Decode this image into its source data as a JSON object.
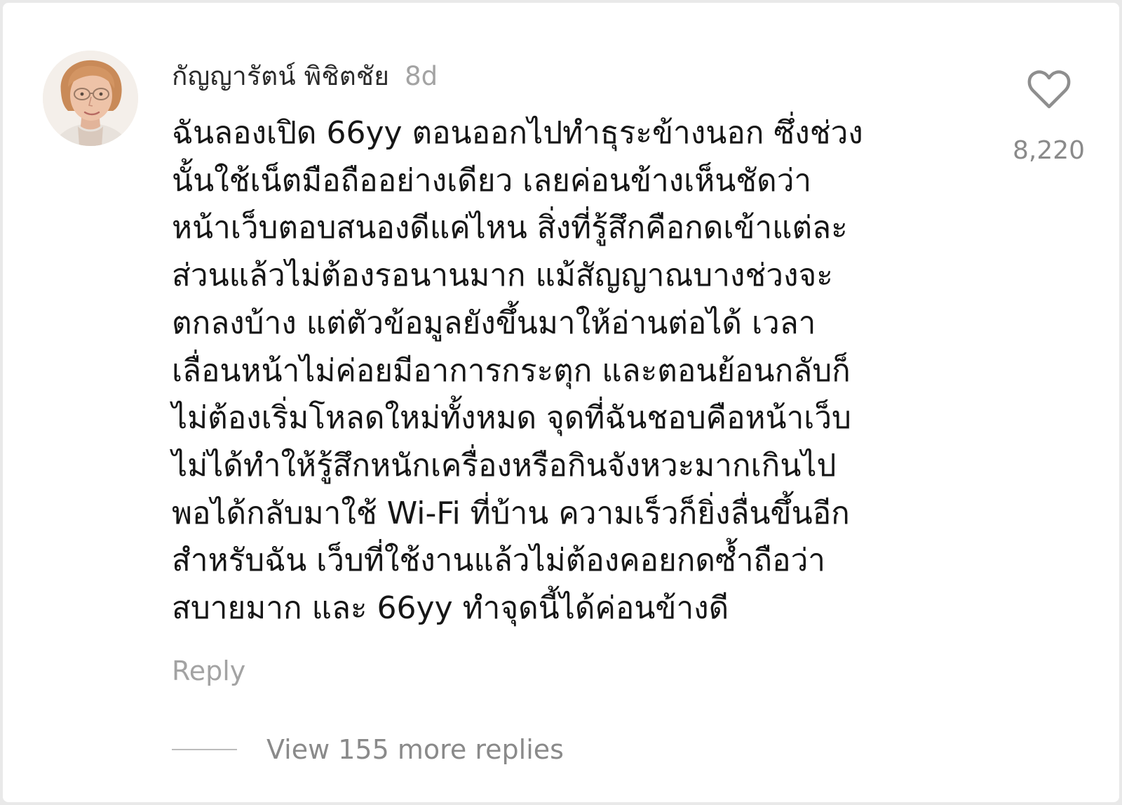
{
  "comment": {
    "username": "กัญญารัตน์ พิชิตชัย",
    "time_ago": "8d",
    "lines": [
      "ฉันลองเปิด 66yy ตอนออกไปทำธุระข้างนอก ซึ่งช่วง",
      "นั้นใช้เน็ตมือถืออย่างเดียว เลยค่อนข้างเห็นชัดว่า",
      "หน้าเว็บตอบสนองดีแค่ไหน สิ่งที่รู้สึกคือกดเข้าแต่ละ",
      "ส่วนแล้วไม่ต้องรอนานมาก แม้สัญญาณบางช่วงจะ",
      "ตกลงบ้าง แต่ตัวข้อมูลยังขึ้นมาให้อ่านต่อได้ เวลา",
      "เลื่อนหน้าไม่ค่อยมีอาการกระตุก และตอนย้อนกลับก็",
      "ไม่ต้องเริ่มโหลดใหม่ทั้งหมด จุดที่ฉันชอบคือหน้าเว็บ",
      "ไม่ได้ทำให้รู้สึกหนักเครื่องหรือกินจังหวะมากเกินไป",
      "พอได้กลับมาใช้ Wi-Fi ที่บ้าน ความเร็วก็ยิ่งลื่นขึ้นอีก",
      "สำหรับฉัน เว็บที่ใช้งานแล้วไม่ต้องคอยกดซ้ำถือว่า",
      "สบายมาก และ 66yy ทำจุดนี้ได้ค่อนข้างดี"
    ],
    "like_icon": "heart-outline-icon",
    "like_count": "8,220",
    "reply_label": "Reply",
    "view_replies_label": "View 155 more replies"
  },
  "colors": {
    "background": "#ffffff",
    "text_primary": "#161616",
    "text_muted": "#a3a3a3",
    "count_text": "#8a8a8a"
  }
}
